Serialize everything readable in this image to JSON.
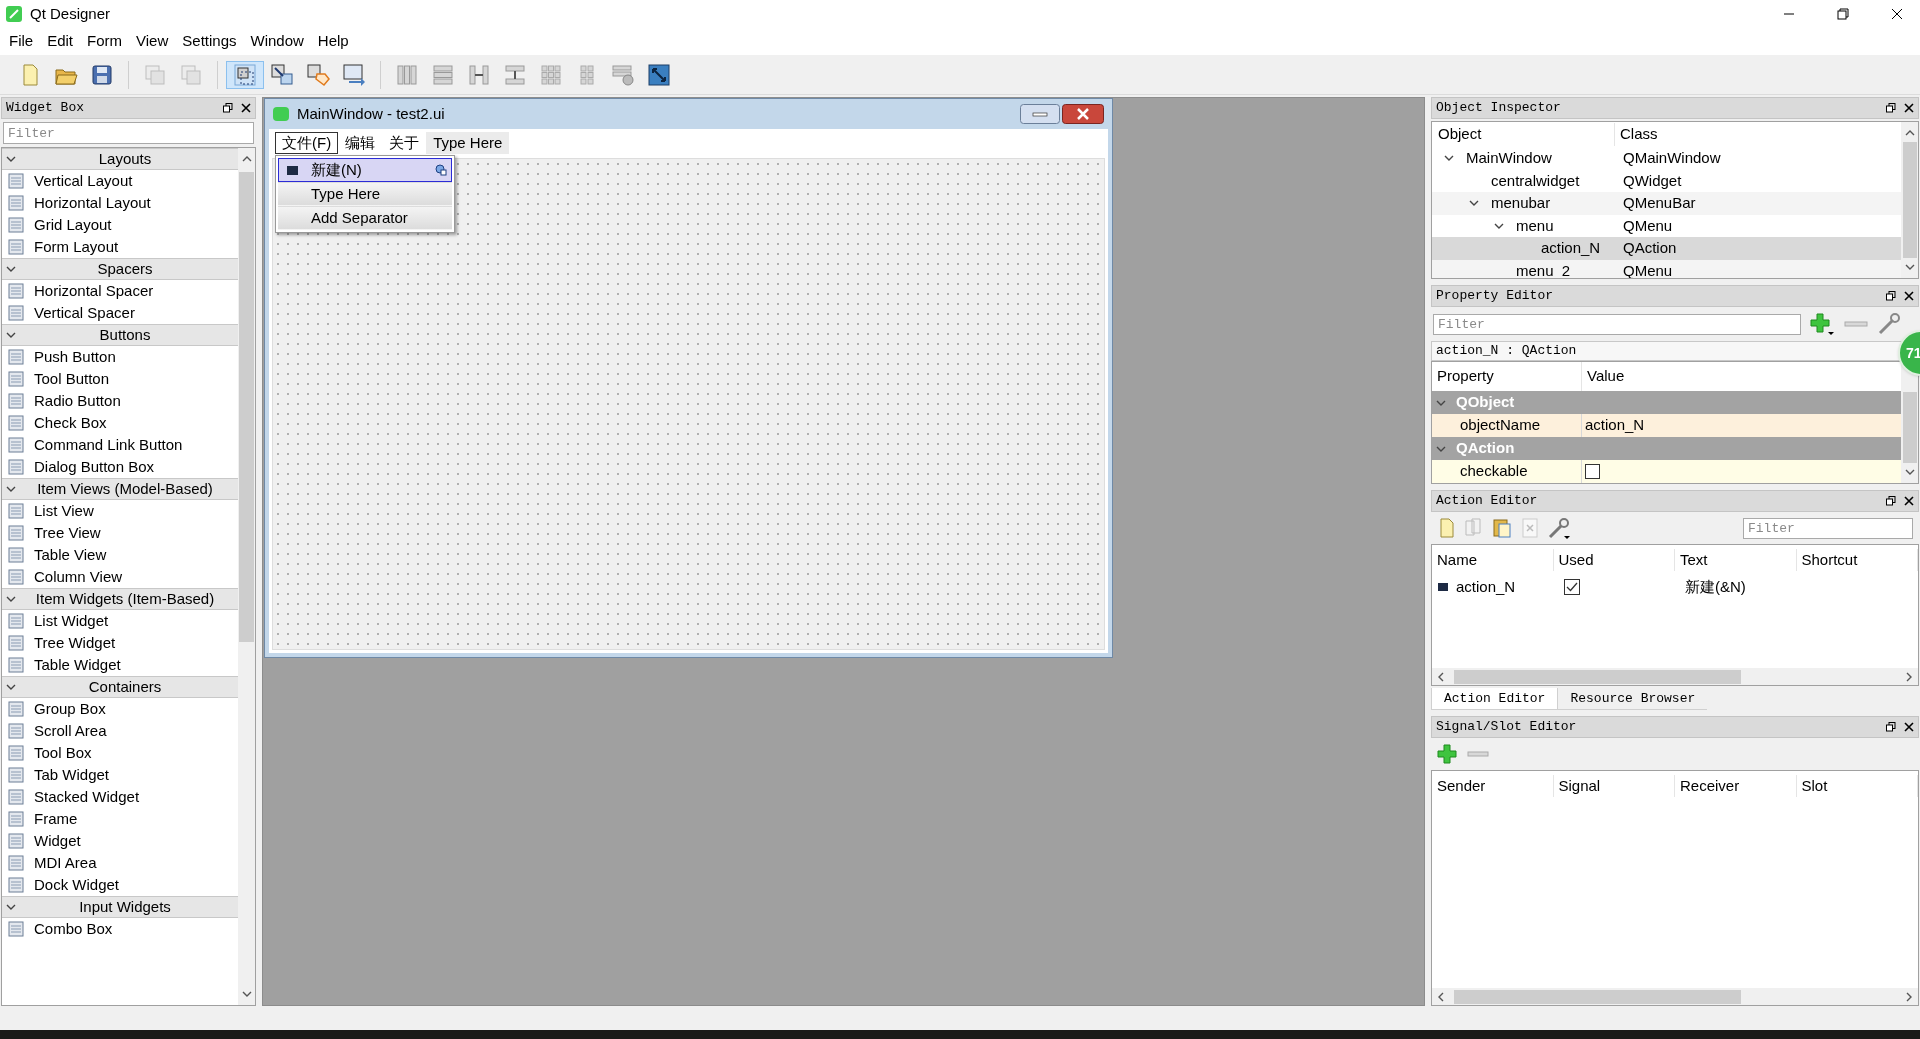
{
  "window": {
    "title": "Qt Designer"
  },
  "menu": [
    "File",
    "Edit",
    "Form",
    "View",
    "Settings",
    "Window",
    "Help"
  ],
  "widget_box": {
    "title": "Widget Box",
    "filter_placeholder": "Filter",
    "sections": [
      {
        "title": "Layouts",
        "expanded": true,
        "items": [
          "Vertical Layout",
          "Horizontal Layout",
          "Grid Layout",
          "Form Layout"
        ]
      },
      {
        "title": "Spacers",
        "expanded": true,
        "items": [
          "Horizontal Spacer",
          "Vertical Spacer"
        ]
      },
      {
        "title": "Buttons",
        "expanded": true,
        "items": [
          "Push Button",
          "Tool Button",
          "Radio Button",
          "Check Box",
          "Command Link Button",
          "Dialog Button Box"
        ]
      },
      {
        "title": "Item Views (Model-Based)",
        "expanded": true,
        "items": [
          "List View",
          "Tree View",
          "Table View",
          "Column View"
        ]
      },
      {
        "title": "Item Widgets (Item-Based)",
        "expanded": true,
        "items": [
          "List Widget",
          "Tree Widget",
          "Table Widget"
        ]
      },
      {
        "title": "Containers",
        "expanded": true,
        "items": [
          "Group Box",
          "Scroll Area",
          "Tool Box",
          "Tab Widget",
          "Stacked Widget",
          "Frame",
          "Widget",
          "MDI Area",
          "Dock Widget"
        ]
      },
      {
        "title": "Input Widgets",
        "expanded": true,
        "items": [
          "Combo Box"
        ]
      }
    ]
  },
  "form": {
    "title": "MainWindow - test2.ui",
    "menus": [
      {
        "label": "文件(F)",
        "selected": true
      },
      {
        "label": "编辑",
        "selected": false
      },
      {
        "label": "关于",
        "selected": false
      },
      {
        "label": "Type Here",
        "selected": false
      }
    ],
    "popup": [
      {
        "label": "新建(N)",
        "kind": "action",
        "selected": true
      },
      {
        "label": "Type Here",
        "kind": "placeholder",
        "selected": false
      },
      {
        "label": "Add Separator",
        "kind": "placeholder",
        "selected": false
      }
    ]
  },
  "object_inspector": {
    "title": "Object Inspector",
    "columns": [
      "Object",
      "Class"
    ],
    "rows": [
      {
        "object": "MainWindow",
        "class": "QMainWindow",
        "selected": false,
        "expanded": true,
        "children": [
          {
            "object": "centralwidget",
            "class": "QWidget",
            "selected": false
          },
          {
            "object": "menubar",
            "class": "QMenuBar",
            "selected": false,
            "expanded": true,
            "children": [
              {
                "object": "menu",
                "class": "QMenu",
                "selected": false,
                "expanded": true,
                "children": [
                  {
                    "object": "action_N",
                    "class": "QAction",
                    "selected": true
                  }
                ]
              },
              {
                "object": "menu_2",
                "class": "QMenu",
                "selected": false
              }
            ]
          }
        ]
      }
    ]
  },
  "property_editor": {
    "title": "Property Editor",
    "filter_placeholder": "Filter",
    "object_label": "action_N : QAction",
    "columns": [
      "Property",
      "Value"
    ],
    "rows": [
      {
        "kind": "group",
        "label": "QObject",
        "expanded": true
      },
      {
        "kind": "text",
        "name": "objectName",
        "value": "action_N"
      },
      {
        "kind": "group",
        "label": "QAction",
        "expanded": true
      },
      {
        "kind": "checkbox",
        "name": "checkable",
        "checked": false
      }
    ]
  },
  "overlay_badge": "71",
  "action_editor": {
    "title": "Action Editor",
    "filter_placeholder": "Filter",
    "columns": [
      "Name",
      "Used",
      "Text",
      "Shortcut"
    ],
    "rows": [
      {
        "name": "action_N",
        "used": true,
        "text": "新建(&N)"
      }
    ],
    "tabs": [
      {
        "label": "Action Editor",
        "selected": true
      },
      {
        "label": "Resource Browser",
        "selected": false
      }
    ]
  },
  "signal_slot_editor": {
    "title": "Signal/Slot Editor",
    "columns": [
      "Sender",
      "Signal",
      "Receiver",
      "Slot"
    ]
  }
}
